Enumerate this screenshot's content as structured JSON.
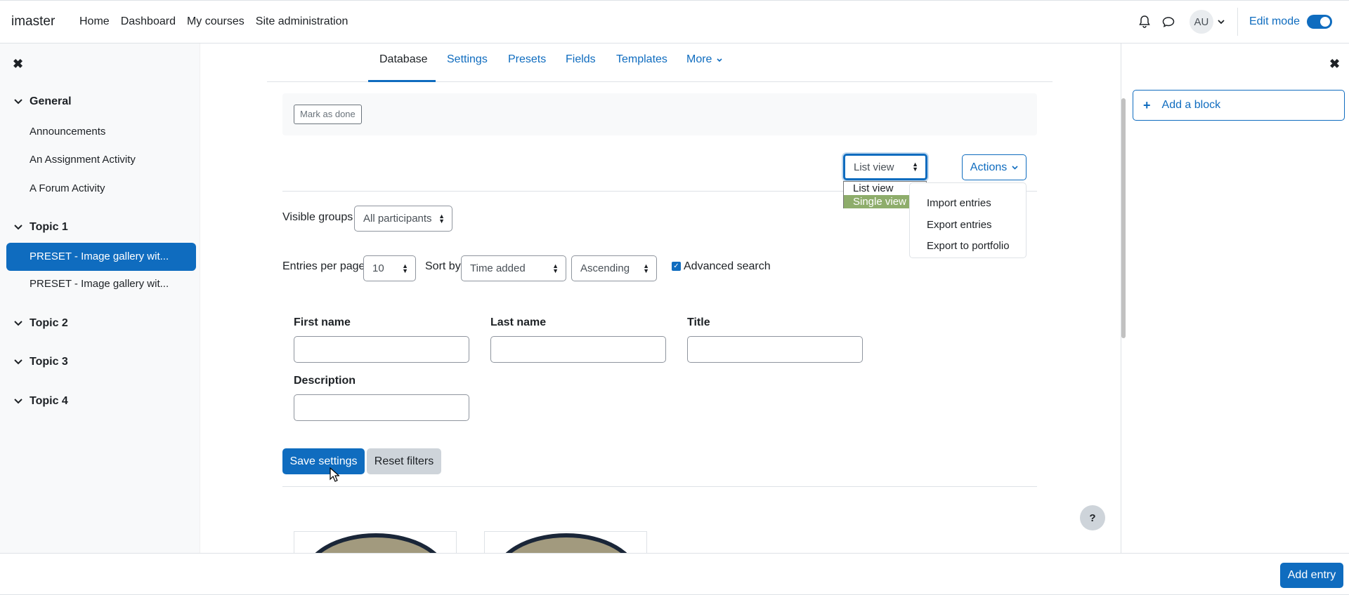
{
  "navbar": {
    "brand": "imaster",
    "links": [
      "Home",
      "Dashboard",
      "My courses",
      "Site administration"
    ],
    "avatar_initials": "AU",
    "edit_mode_label": "Edit mode",
    "edit_mode_on": true
  },
  "course_index": {
    "sections": [
      {
        "title": "General",
        "activities": [
          "Announcements",
          "An Assignment Activity",
          "A Forum Activity"
        ]
      },
      {
        "title": "Topic 1",
        "activities": [
          "PRESET - Image gallery wit...",
          "PRESET - Image gallery wit..."
        ]
      },
      {
        "title": "Topic 2",
        "activities": []
      },
      {
        "title": "Topic 3",
        "activities": []
      },
      {
        "title": "Topic 4",
        "activities": []
      }
    ]
  },
  "tabs": [
    "Database",
    "Settings",
    "Presets",
    "Fields",
    "Templates",
    "More"
  ],
  "active_tab": "Database",
  "completion": {
    "mark_done_label": "Mark as done"
  },
  "view_select": {
    "value": "List view",
    "options": [
      "List view",
      "Single view"
    ],
    "highlighted": "Single view"
  },
  "actions": {
    "label": "Actions",
    "menu": [
      "Import entries",
      "Export entries",
      "Export to portfolio"
    ]
  },
  "filters": {
    "visible_groups_label": "Visible groups",
    "visible_groups_value": "All participants",
    "entries_per_page_label": "Entries per page",
    "entries_per_page_value": "10",
    "sort_by_label": "Sort by",
    "sort_by_value": "Time added",
    "order_value": "Ascending",
    "advanced_search_label": "Advanced search",
    "advanced_search_checked": true
  },
  "advanced_fields": {
    "first_name": "First name",
    "last_name": "Last name",
    "title": "Title",
    "description": "Description"
  },
  "buttons": {
    "save_settings": "Save settings",
    "reset_filters": "Reset filters",
    "add_entry": "Add entry",
    "help": "?"
  },
  "right_drawer": {
    "add_block_label": "Add a block"
  },
  "colors": {
    "primary": "#0f6cbf",
    "highlight_option": "#8ead6b"
  }
}
